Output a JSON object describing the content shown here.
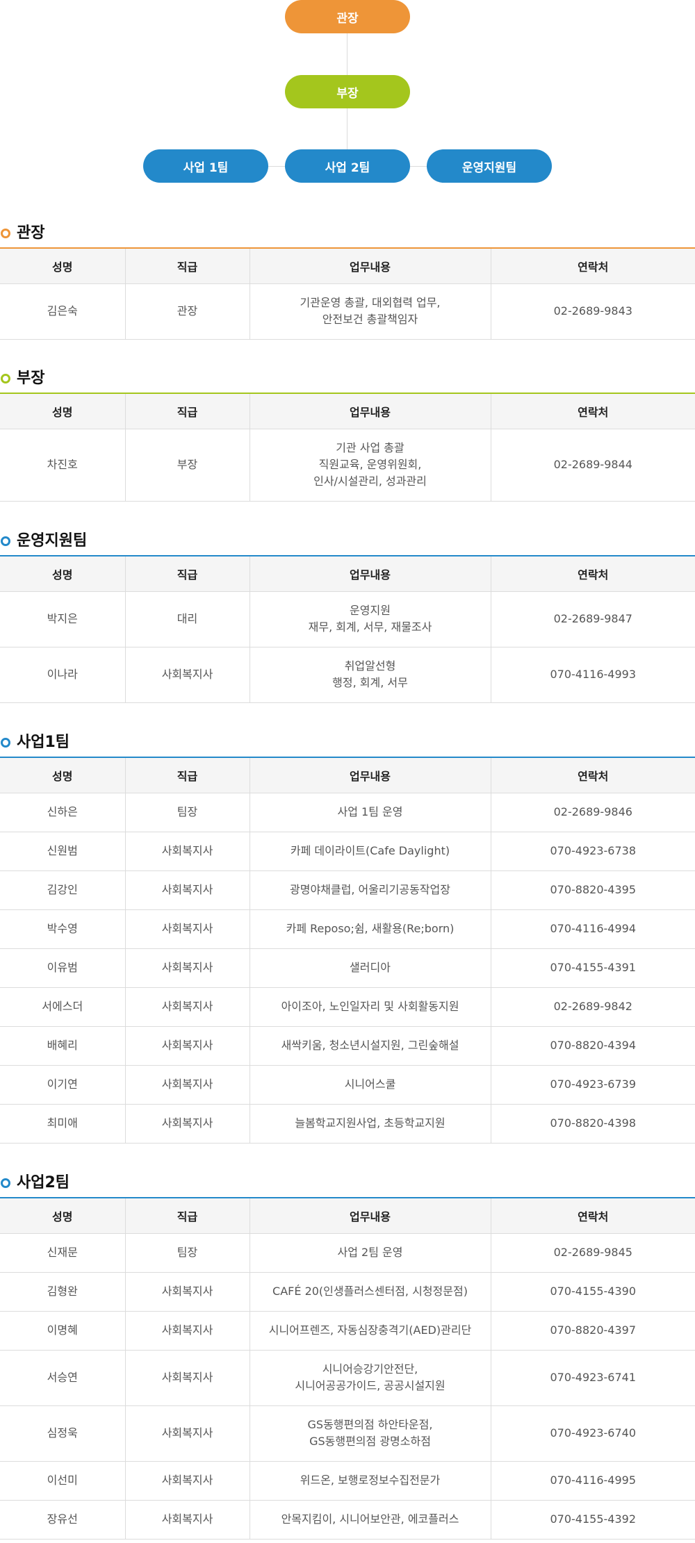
{
  "org_chart": {
    "top": "관장",
    "mid": "부장",
    "teams": [
      "사업 1팀",
      "사업 2팀",
      "운영지원팀"
    ]
  },
  "colors": {
    "orange": "#ee9538",
    "green": "#a4c61d",
    "blue": "#2389ca"
  },
  "headers": [
    "성명",
    "직급",
    "업무내용",
    "연락처"
  ],
  "sections": [
    {
      "title": "관장",
      "rows": [
        {
          "name": "김은숙",
          "rank": "관장",
          "duty": "기관운영 총괄, 대외협력 업무,\n안전보건 총괄책임자",
          "contact": "02-2689-9843"
        }
      ]
    },
    {
      "title": "부장",
      "rows": [
        {
          "name": "차진호",
          "rank": "부장",
          "duty": "기관 사업 총괄\n직원교육, 운영위원회,\n인사/시설관리, 성과관리",
          "contact": "02-2689-9844"
        }
      ]
    },
    {
      "title": "운영지원팀",
      "rows": [
        {
          "name": "박지은",
          "rank": "대리",
          "duty": "운영지원\n재무, 회계, 서무, 재물조사",
          "contact": "02-2689-9847"
        },
        {
          "name": "이나라",
          "rank": "사회복지사",
          "duty": "취업알선형\n행정, 회계, 서무",
          "contact": "070-4116-4993"
        }
      ]
    },
    {
      "title": "사업1팀",
      "rows": [
        {
          "name": "신하은",
          "rank": "팀장",
          "duty": "사업 1팀 운영",
          "contact": "02-2689-9846"
        },
        {
          "name": "신원범",
          "rank": "사회복지사",
          "duty": "카페 데이라이트(Cafe Daylight)",
          "contact": "070-4923-6738"
        },
        {
          "name": "김강인",
          "rank": "사회복지사",
          "duty": "광명야채클럽, 어울리기공동작업장",
          "contact": "070-8820-4395"
        },
        {
          "name": "박수영",
          "rank": "사회복지사",
          "duty": "카페 Reposo;쉼, 새활용(Re;born)",
          "contact": "070-4116-4994"
        },
        {
          "name": "이유범",
          "rank": "사회복지사",
          "duty": "샐러디아",
          "contact": "070-4155-4391"
        },
        {
          "name": "서에스더",
          "rank": "사회복지사",
          "duty": "아이조아, 노인일자리 및 사회활동지원",
          "contact": "02-2689-9842"
        },
        {
          "name": "배혜리",
          "rank": "사회복지사",
          "duty": "새싹키움, 청소년시설지원, 그린숲해설",
          "contact": "070-8820-4394"
        },
        {
          "name": "이기연",
          "rank": "사회복지사",
          "duty": "시니어스쿨",
          "contact": "070-4923-6739"
        },
        {
          "name": "최미애",
          "rank": "사회복지사",
          "duty": "늘봄학교지원사업, 초등학교지원",
          "contact": "070-8820-4398"
        }
      ]
    },
    {
      "title": "사업2팀",
      "rows": [
        {
          "name": "신재문",
          "rank": "팀장",
          "duty": "사업 2팀 운영",
          "contact": "02-2689-9845"
        },
        {
          "name": "김형완",
          "rank": "사회복지사",
          "duty": "CAFÉ 20(인생플러스센터점, 시청정문점)",
          "contact": "070-4155-4390"
        },
        {
          "name": "이명혜",
          "rank": "사회복지사",
          "duty": "시니어프렌즈, 자동심장충격기(AED)관리단",
          "contact": "070-8820-4397"
        },
        {
          "name": "서승연",
          "rank": "사회복지사",
          "duty": "시니어승강기안전단,\n시니어공공가이드, 공공시설지원",
          "contact": "070-4923-6741"
        },
        {
          "name": "심정욱",
          "rank": "사회복지사",
          "duty": "GS동행편의점 하안타운점,\nGS동행편의점 광명소하점",
          "contact": "070-4923-6740"
        },
        {
          "name": "이선미",
          "rank": "사회복지사",
          "duty": "위드온, 보행로정보수집전문가",
          "contact": "070-4116-4995"
        },
        {
          "name": "장유선",
          "rank": "사회복지사",
          "duty": "안목지킴이, 시니어보안관, 에코플러스",
          "contact": "070-4155-4392"
        }
      ]
    }
  ]
}
